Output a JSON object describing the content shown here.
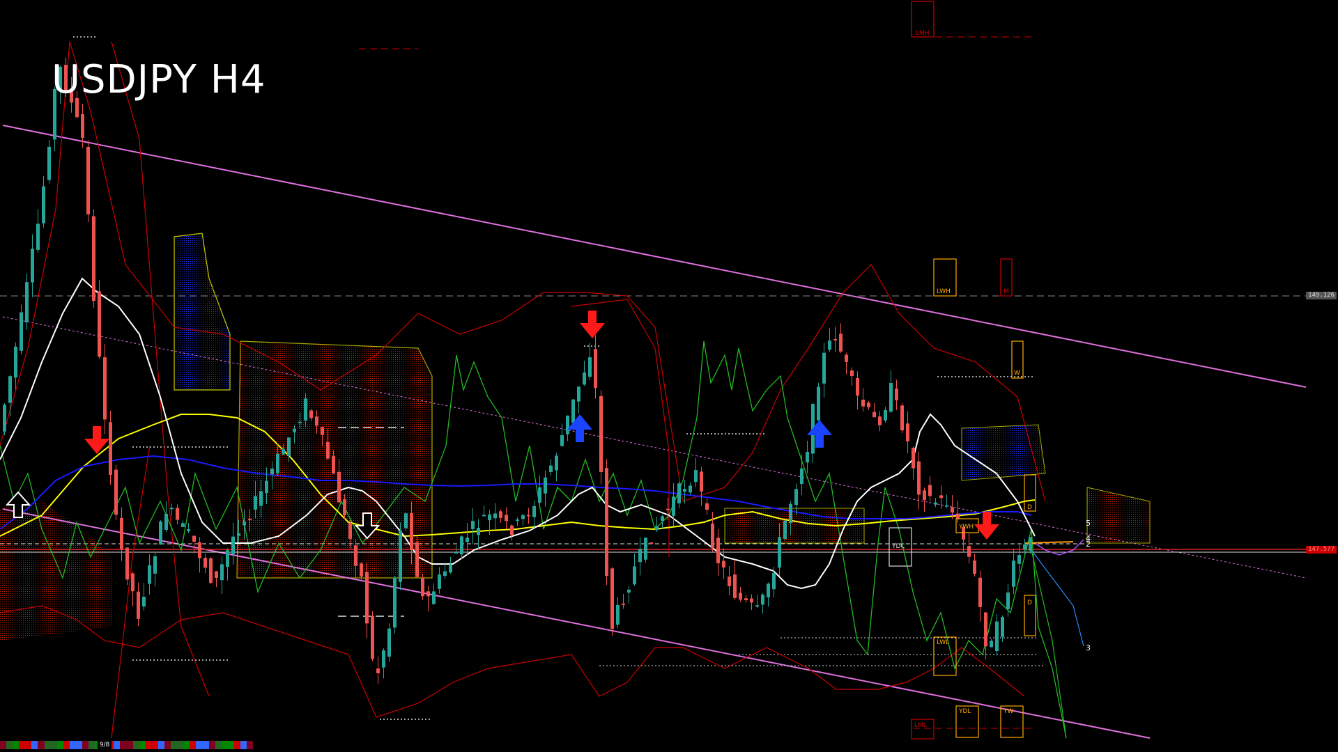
{
  "title": "USDJPY H4",
  "price_labels": {
    "upper": "149.126",
    "current": "147.5??"
  },
  "status": {
    "label": "9/8"
  },
  "wave_labels": [
    "5",
    "4",
    "2",
    "3"
  ],
  "level_labels": [
    "LMH",
    "LWH",
    "M",
    "W",
    "D",
    "YWH",
    "YDC",
    "D",
    "LWL",
    "YDL",
    "YW",
    "LML"
  ],
  "colors": {
    "background": "#000000",
    "bull_candle": "#26a69a",
    "bear_candle": "#ef5350",
    "channel": "#e070e0",
    "ma_white": "#ffffff",
    "ma_yellow": "#ffff00",
    "ma_blue": "#1a1aff",
    "envelope": "#cc0000",
    "oscillator": "#22bb22",
    "cloud_bull": "#1a1aff",
    "cloud_bear": "#aa2200",
    "level_box": "#ffaa00",
    "sell_arrow": "#ff1a1a",
    "buy_arrow": "#1a44ff"
  },
  "chart_data": {
    "type": "candlestick",
    "symbol": "USDJPY",
    "timeframe": "H4",
    "ylim": [
      146.3,
      150.2
    ],
    "bars": 120
  }
}
